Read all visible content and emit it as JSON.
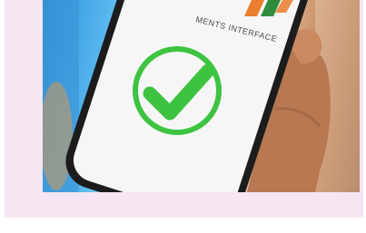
{
  "photo": {
    "subject": "hand-holding-phone-with-checkmark",
    "screen_caption": "MENTS INTERFACE",
    "colors": {
      "background_card": "#f5e6f1",
      "checkmark_green": "#3ec341",
      "phone_body": "#1c1c1c",
      "phone_screen": "#f6f6f6",
      "logo_orange": "#e97e2c",
      "logo_green": "#2d8d3c",
      "caption_text": "#4a4a4a"
    }
  }
}
